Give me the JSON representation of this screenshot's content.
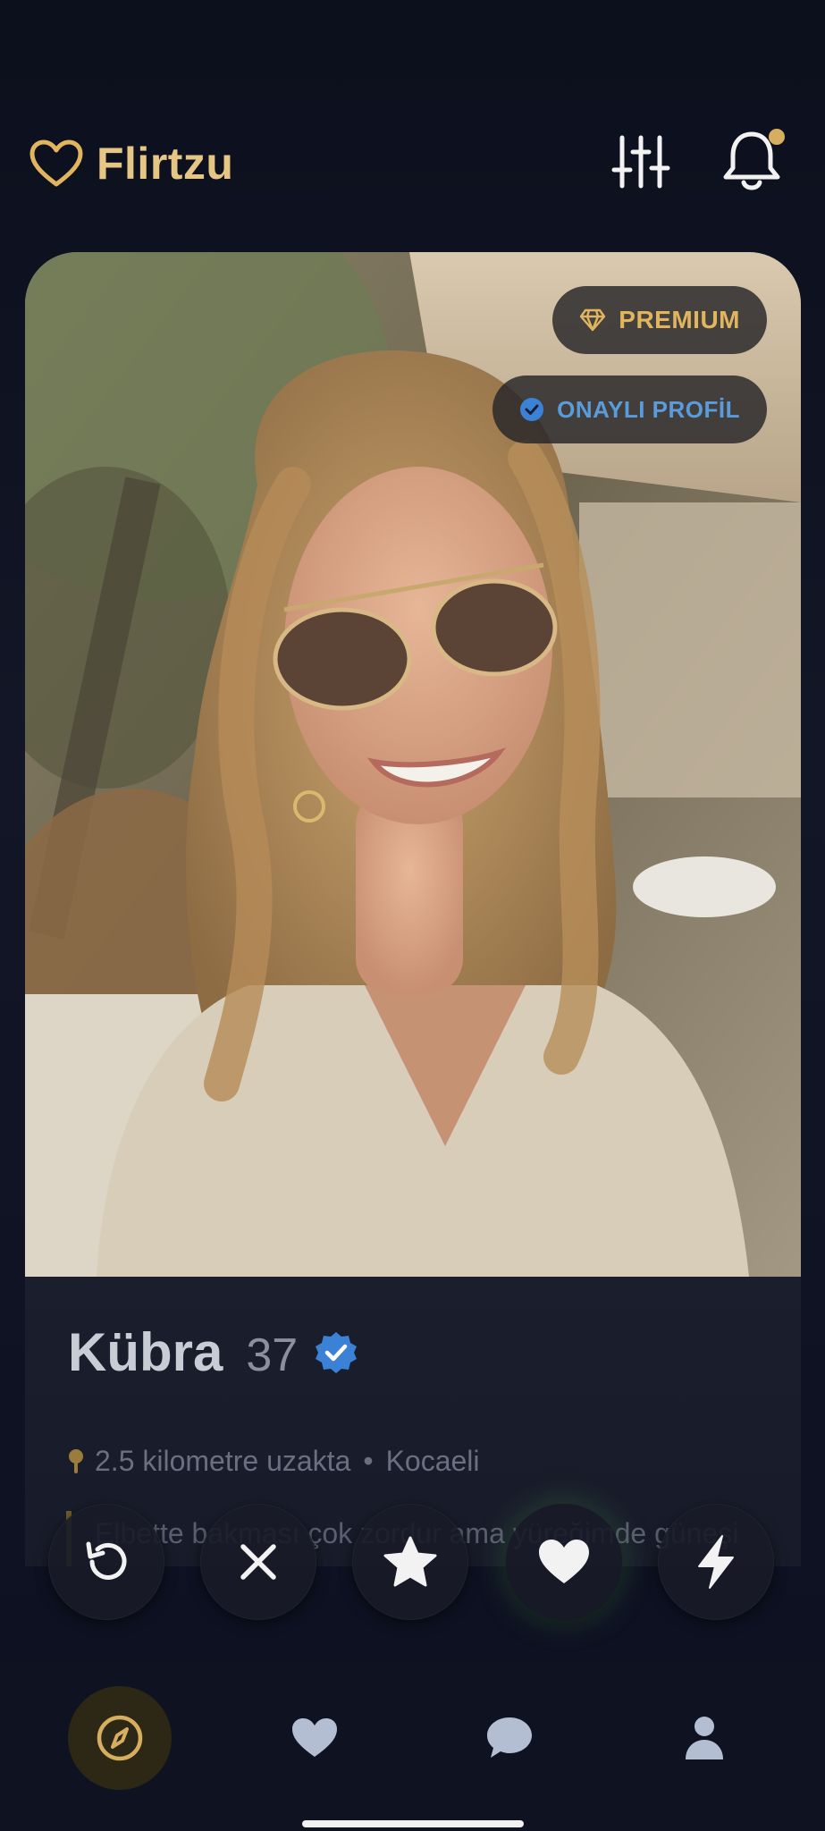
{
  "app": {
    "name": "Flirtzu",
    "accent_color": "#e6c684"
  },
  "header": {
    "logo_icon": "heart-outline-icon",
    "filter_icon": "sliders-icon",
    "notification_icon": "bell-icon",
    "has_unread_notifications": true
  },
  "profile": {
    "badges": {
      "premium": "PREMIUM",
      "verified": "ONAYLI PROFİL"
    },
    "name": "Kübra",
    "age": "37",
    "distance": "2.5 kilometre uzakta",
    "separator": "•",
    "city": "Kocaeli",
    "bio": "Elbette bakması çok zordur ama yüreğimde güneşi bulurmu..."
  },
  "actions": [
    {
      "icon": "undo-icon",
      "label": "rewind"
    },
    {
      "icon": "close-icon",
      "label": "nope"
    },
    {
      "icon": "star-icon",
      "label": "super-like"
    },
    {
      "icon": "heart-icon",
      "label": "like"
    },
    {
      "icon": "bolt-icon",
      "label": "boost"
    }
  ],
  "nav": [
    {
      "icon": "compass-icon",
      "active": true
    },
    {
      "icon": "heart-icon",
      "active": false
    },
    {
      "icon": "chat-bubble-icon",
      "active": false
    },
    {
      "icon": "user-icon",
      "active": false
    }
  ],
  "colors": {
    "background": "#0e1120",
    "premium": "#e1b55e",
    "verified": "#3b82d6"
  }
}
